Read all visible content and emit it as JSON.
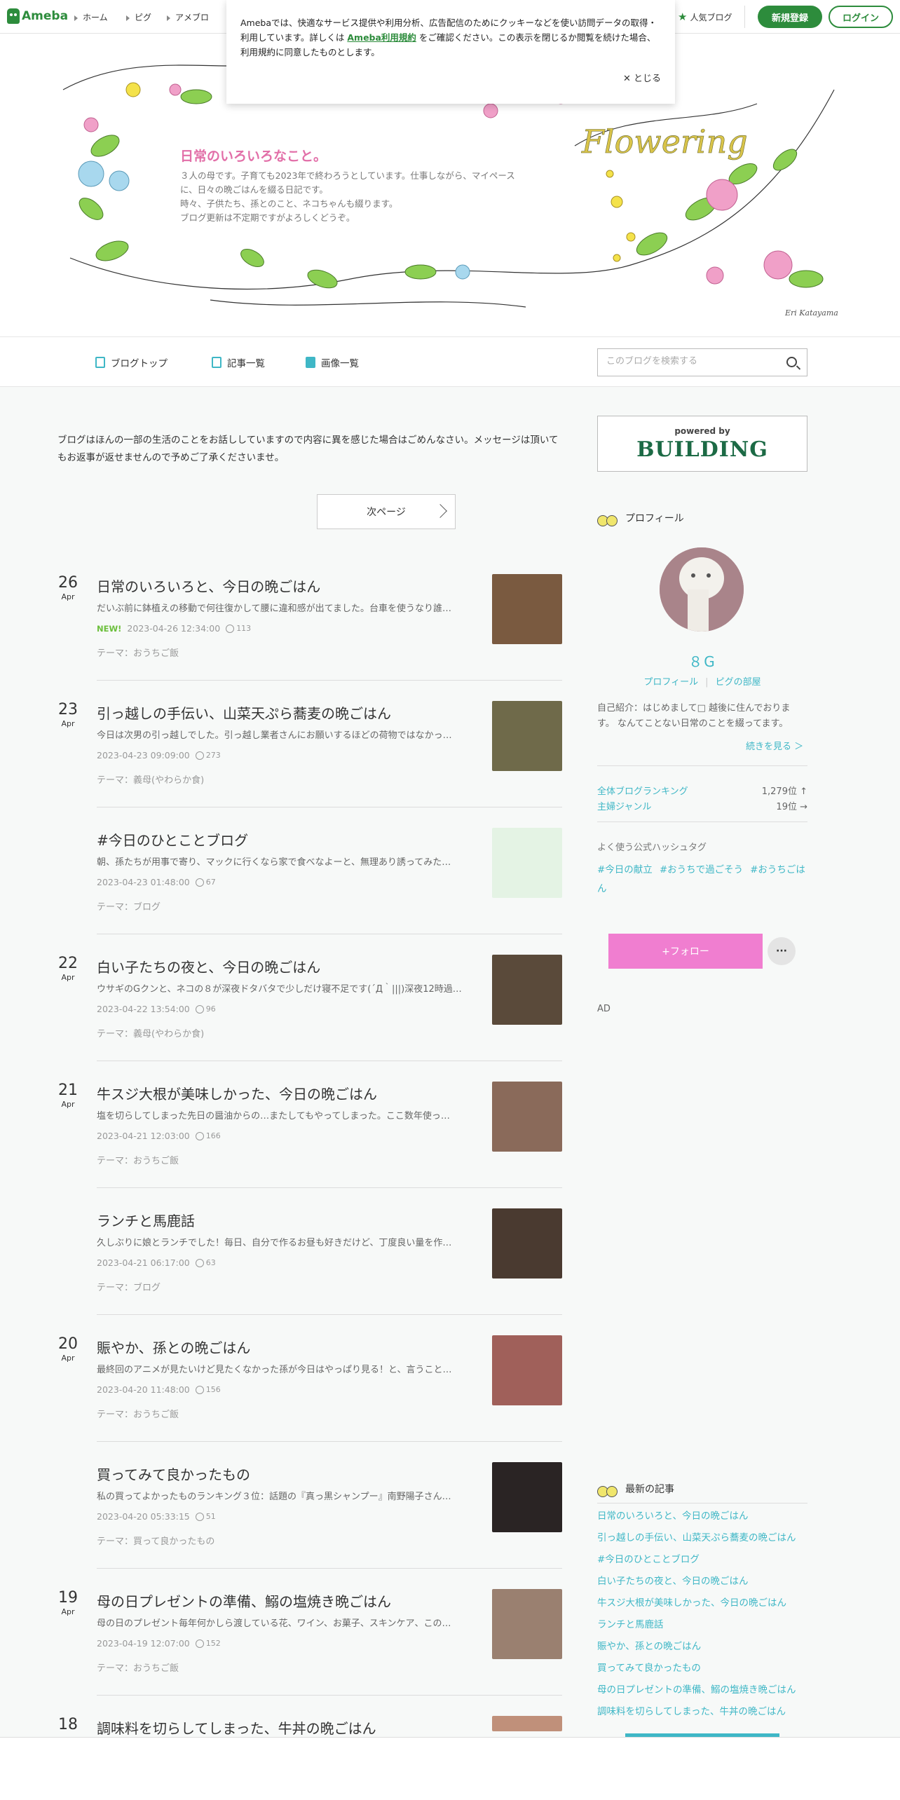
{
  "topbar": {
    "logo": "Ameba",
    "nav": [
      "ホーム",
      "ピグ",
      "アメブロ"
    ],
    "popular": "人気ブログ",
    "register": "新規登録",
    "login": "ログイン"
  },
  "cookie": {
    "text1": "Amebaでは、快適なサービス提供や利用分析、広告配信のためにクッキーなどを使い訪問データの取得・利用しています。詳しくは",
    "link": "Ameba利用規約",
    "text2": "をご確認ください。この表示を閉じるか閲覧を続けた場合、利用規約に同意したものとします。",
    "close": "とじる"
  },
  "header": {
    "title": "日常のいろいろなこと。",
    "description": "３人の母です。子育ても2023年で終わろうとしています。仕事しながら、マイペースに、日々の晩ごはんを綴る日記です。\n時々、子供たち、孫とのこと、ネコちゃんも綴ります。\nブログ更新は不定期ですがよろしくどうぞ。",
    "art_text": "Flowering",
    "signature": "Eri Katayama"
  },
  "subnav": {
    "top": "ブログトップ",
    "entries": "記事一覧",
    "images": "画像一覧",
    "search_placeholder": "このブログを検索する"
  },
  "notice": "ブログはほんの一部の生活のことをお話ししていますので内容に異を感じた場合はごめんなさい。メッセージは頂いてもお返事が返せませんので予めご了承くださいませ。",
  "next_page": "次ページ",
  "entries": [
    {
      "day": "26",
      "month": "Apr",
      "title": "日常のいろいろと、今日の晩ごはん",
      "excerpt": "だいぶ前に鉢植えの移動で何往復かして腰に違和感が出てました。台車を使うなり誰…",
      "new": "NEW!",
      "date": "2023-04-26 12:34:00",
      "likes": "113",
      "theme": "テーマ：おうちご飯",
      "thumb": "#7a5a40"
    },
    {
      "day": "23",
      "month": "Apr",
      "title": "引っ越しの手伝い、山菜天ぷら蕎麦の晩ごはん",
      "excerpt": "今日は次男の引っ越しでした。引っ越し業者さんにお願いするほどの荷物ではなかっ…",
      "new": "",
      "date": "2023-04-23 09:09:00",
      "likes": "273",
      "theme": "テーマ：義母(やわらか食)",
      "thumb": "#6f6a4a"
    },
    {
      "day": "",
      "month": "",
      "title": "#今日のひとことブログ",
      "excerpt": "朝、孫たちが用事で寄り、マックに行くなら家で食べなよーと、無理あり誘ってみた…",
      "new": "",
      "date": "2023-04-23 01:48:00",
      "likes": "67",
      "theme": "テーマ：ブログ",
      "thumb": "#e4f3e4"
    },
    {
      "day": "22",
      "month": "Apr",
      "title": "白い子たちの夜と、今日の晩ごはん",
      "excerpt": "ウサギのGクンと、ネコの８が深夜ドタバタで少しだけ寝不足です(´Д｀|||)深夜12時過…",
      "new": "",
      "date": "2023-04-22 13:54:00",
      "likes": "96",
      "theme": "テーマ：義母(やわらか食)",
      "thumb": "#5a4a3a"
    },
    {
      "day": "21",
      "month": "Apr",
      "title": "牛スジ大根が美味しかった、今日の晩ごはん",
      "excerpt": "塩を切らしてしまった先日の醤油からの…またしてもやってしまった。ここ数年使っ…",
      "new": "",
      "date": "2023-04-21 12:03:00",
      "likes": "166",
      "theme": "テーマ：おうちご飯",
      "thumb": "#8a6a5a"
    },
    {
      "day": "",
      "month": "",
      "title": "ランチと馬鹿話",
      "excerpt": "久しぶりに娘とランチでした！毎日、自分で作るお昼も好きだけど、丁度良い量を作…",
      "new": "",
      "date": "2023-04-21 06:17:00",
      "likes": "63",
      "theme": "テーマ：ブログ",
      "thumb": "#4a3a30"
    },
    {
      "day": "20",
      "month": "Apr",
      "title": "賑やか、孫との晩ごはん",
      "excerpt": "最終回のアニメが見たいけど見たくなかった孫が今日はやっぱり見る！と、言うこと…",
      "new": "",
      "date": "2023-04-20 11:48:00",
      "likes": "156",
      "theme": "テーマ：おうちご飯",
      "thumb": "#a0605a"
    },
    {
      "day": "",
      "month": "",
      "title": "買ってみて良かったもの",
      "excerpt": "私の買ってよかったものランキング３位：話題の『真っ黒シャンプー』南野陽子さん…",
      "new": "",
      "date": "2023-04-20 05:33:15",
      "likes": "51",
      "theme": "テーマ：買って良かったもの",
      "thumb": "#2a2424"
    },
    {
      "day": "19",
      "month": "Apr",
      "title": "母の日プレゼントの準備、鰯の塩焼き晩ごはん",
      "excerpt": "母の日のプレゼント毎年何かしら渡している花、ワイン、お菓子、スキンケア、この…",
      "new": "",
      "date": "2023-04-19 12:07:00",
      "likes": "152",
      "theme": "テーマ：おうちご飯",
      "thumb": "#9a8070"
    },
    {
      "day": "18",
      "month": "",
      "title": "調味料を切らしてしまった、牛丼の晩ごはん",
      "excerpt": "",
      "new": "",
      "date": "",
      "likes": "",
      "theme": "",
      "thumb": "#c0907a"
    }
  ],
  "sidebar": {
    "ad_powered": "powered by",
    "ad_brand": "BUILDING",
    "profile_head": "プロフィール",
    "name": "８G",
    "profile_link": "プロフィール",
    "pig_link": "ピグの部屋",
    "intro": "自己紹介：はじめまして□ 越後に住んでおります。 なんてことない日常のことを綴ってます。",
    "more": "続きを見る ＞",
    "rank_all": "全体ブログランキング",
    "rank_all_val": "1,279位 ↑",
    "rank_genre": "主婦ジャンル",
    "rank_genre_val": "19位 →",
    "hash_label": "よく使う公式ハッシュタグ",
    "hashtags": [
      "#今日の献立",
      "#おうちで過ごそう",
      "#おうちごはん"
    ],
    "follow": "+フォロー",
    "more_btn": "···",
    "ad_label": "AD",
    "recent_head": "最新の記事",
    "recent": [
      "日常のいろいろと、今日の晩ごはん",
      "引っ越しの手伝い、山菜天ぷら蕎麦の晩ごはん",
      "#今日のひとことブログ",
      "白い子たちの夜と、今日の晩ごはん",
      "牛スジ大根が美味しかった、今日の晩ごはん",
      "ランチと馬鹿話",
      "賑やか、孫との晩ごはん",
      "買ってみて良かったもの",
      "母の日プレゼントの準備、鰯の塩焼き晩ごはん",
      "調味料を切らしてしまった、牛丼の晩ごはん"
    ]
  },
  "colors": {
    "brand": "#2d8c3c",
    "accent": "#3fb7c6",
    "title_pink": "#e26fa8",
    "follow_pink": "#f07ed0"
  }
}
